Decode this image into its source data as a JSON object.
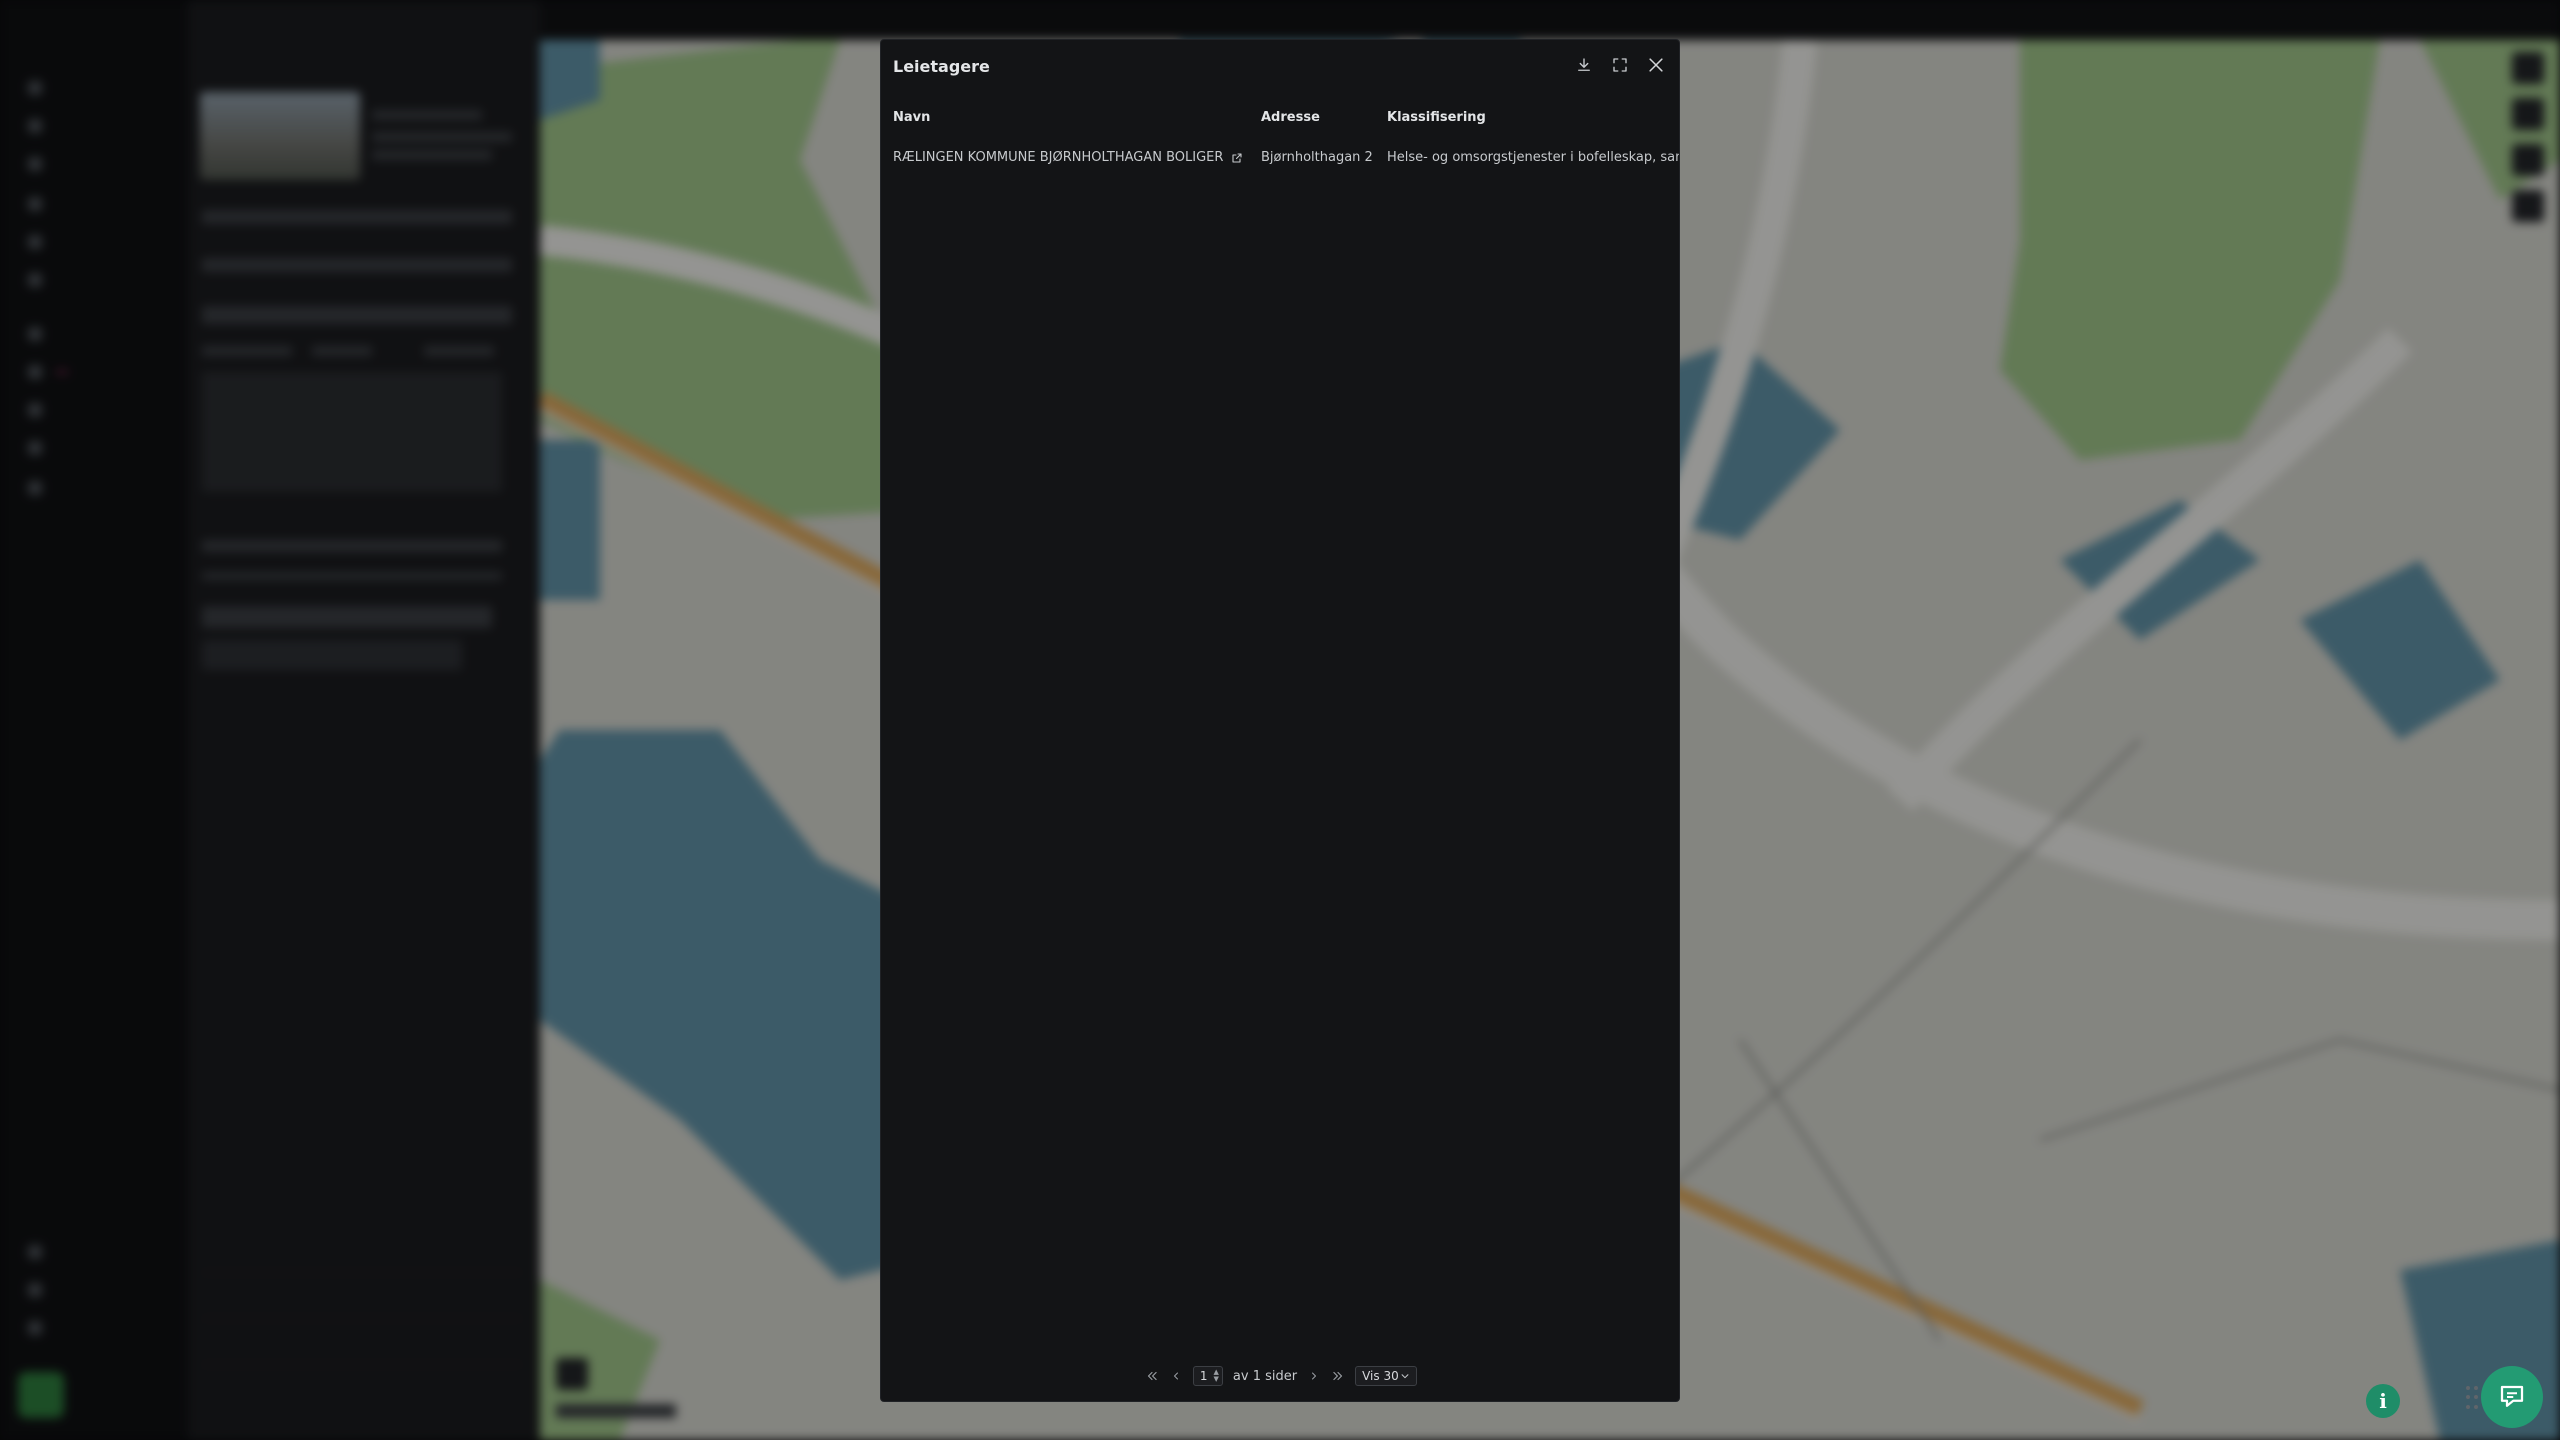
{
  "modal": {
    "title": "Leietagere",
    "actions": {
      "download_icon": "download-icon",
      "fullscreen_icon": "expand-icon",
      "close_icon": "close-icon"
    },
    "columns": [
      "Navn",
      "Adresse",
      "Klassifisering"
    ],
    "rows": [
      {
        "navn": "RÆLINGEN KOMMUNE BJØRNHOLTHAGAN BOLIGER",
        "adresse": "Bjørnholthagan 2",
        "klassifisering": "Helse- og omsorgstjenester i bofelleskap, samlokaliserte boliger"
      }
    ],
    "pagination": {
      "current_page": "1",
      "of_label": "av 1 sider",
      "page_size_label": "Vis 30"
    }
  },
  "colors": {
    "modal_bg": "#131416",
    "accent": "#239b73",
    "water": "#5f8fa3",
    "park": "#9bbf86",
    "road": "#d5a35b"
  }
}
